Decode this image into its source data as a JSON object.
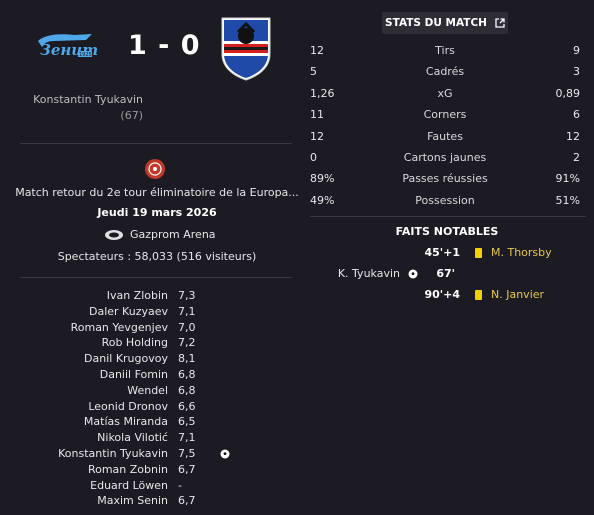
{
  "match": {
    "home_team_logo": "zenit-logo",
    "away_team_logo": "sampdoria-crest",
    "score": "1 - 0",
    "home_scorer": "Konstantin Tyukavin",
    "home_scorer_minute": "(67)",
    "competition_icon": "uefa-competition-icon",
    "description": "Match retour du 2e tour éliminatoire de la Europa...",
    "date": "Jeudi 19 mars 2026",
    "stadium_icon": "stadium-icon",
    "stadium": "Gazprom Arena",
    "spectators": "Spectateurs : 58,033 (516 visiteurs)"
  },
  "ratings": [
    {
      "name": "Ivan Zlobin",
      "rating": "7,3",
      "event": ""
    },
    {
      "name": "Daler Kuzyaev",
      "rating": "7,1",
      "event": ""
    },
    {
      "name": "Roman Yevgenjev",
      "rating": "7,0",
      "event": ""
    },
    {
      "name": "Rob Holding",
      "rating": "7,2",
      "event": ""
    },
    {
      "name": "Danil Krugovoy",
      "rating": "8,1",
      "event": ""
    },
    {
      "name": "Daniil Fomin",
      "rating": "6,8",
      "event": ""
    },
    {
      "name": "Wendel",
      "rating": "6,8",
      "event": ""
    },
    {
      "name": "Leonid Dronov",
      "rating": "6,6",
      "event": ""
    },
    {
      "name": "Matías Miranda",
      "rating": "6,5",
      "event": ""
    },
    {
      "name": "Nikola Vilotić",
      "rating": "7,1",
      "event": ""
    },
    {
      "name": "Konstantin Tyukavin",
      "rating": "7,5",
      "event": "goal-icon"
    },
    {
      "name": "Roman Zobnin",
      "rating": "6,7",
      "event": ""
    },
    {
      "name": "Eduard Löwen",
      "rating": "-",
      "event": ""
    },
    {
      "name": "Maxim Senin",
      "rating": "6,7",
      "event": ""
    }
  ],
  "stats": {
    "header": "STATS DU MATCH",
    "header_icon": "expand-icon",
    "rows": [
      {
        "home": "12",
        "label": "Tirs",
        "away": "9"
      },
      {
        "home": "5",
        "label": "Cadrés",
        "away": "3"
      },
      {
        "home": "1,26",
        "label": "xG",
        "away": "0,89"
      },
      {
        "home": "11",
        "label": "Corners",
        "away": "6"
      },
      {
        "home": "12",
        "label": "Fautes",
        "away": "12"
      },
      {
        "home": "0",
        "label": "Cartons jaunes",
        "away": "2"
      },
      {
        "home": "89%",
        "label": "Passes réussies",
        "away": "91%"
      },
      {
        "home": "49%",
        "label": "Possession",
        "away": "51%"
      }
    ]
  },
  "events": {
    "title": "FAITS NOTABLES",
    "items": [
      {
        "minute": "45'+1",
        "player": "M. Thorsby",
        "side": "away",
        "icon": "yellow-card-icon"
      },
      {
        "minute": "67'",
        "player": "K. Tyukavin",
        "side": "home",
        "icon": "goal-icon"
      },
      {
        "minute": "90'+4",
        "player": "N. Janvier",
        "side": "away",
        "icon": "yellow-card-icon"
      }
    ]
  },
  "colors": {
    "background": "#1c1a22",
    "card_yellow": "#f2d200",
    "away_player_text": "#e6c84a"
  }
}
